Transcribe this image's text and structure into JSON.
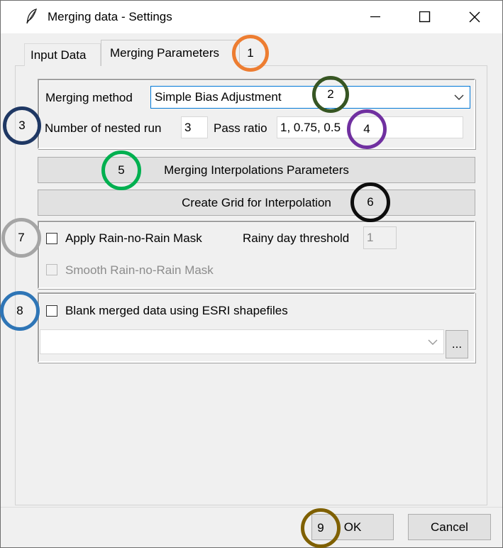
{
  "window": {
    "title": "Merging data - Settings",
    "icon": "feather-icon",
    "controls": [
      "minimize-icon",
      "maximize-icon",
      "close-icon"
    ]
  },
  "tabs": [
    {
      "label": "Input Data",
      "active": false
    },
    {
      "label": "Merging Parameters",
      "active": true
    }
  ],
  "merging": {
    "method_label": "Merging method",
    "method_value": "Simple Bias Adjustment",
    "nested_label": "Number of nested run",
    "nested_value": "3",
    "pass_label": "Pass ratio",
    "pass_value": "1, 0.75, 0.5"
  },
  "buttons": {
    "interp_params": "Merging Interpolations Parameters",
    "create_grid": "Create Grid for Interpolation",
    "browse": "...",
    "ok": "OK",
    "cancel": "Cancel"
  },
  "rain_mask": {
    "apply_label": "Apply Rain-no-Rain Mask",
    "apply_checked": false,
    "threshold_label": "Rainy day threshold",
    "threshold_value": "1",
    "smooth_label": "Smooth Rain-no-Rain Mask",
    "smooth_checked": false,
    "smooth_enabled": false
  },
  "blank": {
    "label": "Blank merged data using ESRI shapefiles",
    "checked": false,
    "shapefile_value": ""
  },
  "annotations": [
    {
      "n": "1",
      "color": "#ed7d31"
    },
    {
      "n": "2",
      "color": "#375623"
    },
    {
      "n": "3",
      "color": "#1f3864"
    },
    {
      "n": "4",
      "color": "#7030a0"
    },
    {
      "n": "5",
      "color": "#00b050"
    },
    {
      "n": "6",
      "color": "#0d0d0d"
    },
    {
      "n": "7",
      "color": "#a5a5a5"
    },
    {
      "n": "8",
      "color": "#2e75b6"
    },
    {
      "n": "9",
      "color": "#7f6000"
    }
  ]
}
